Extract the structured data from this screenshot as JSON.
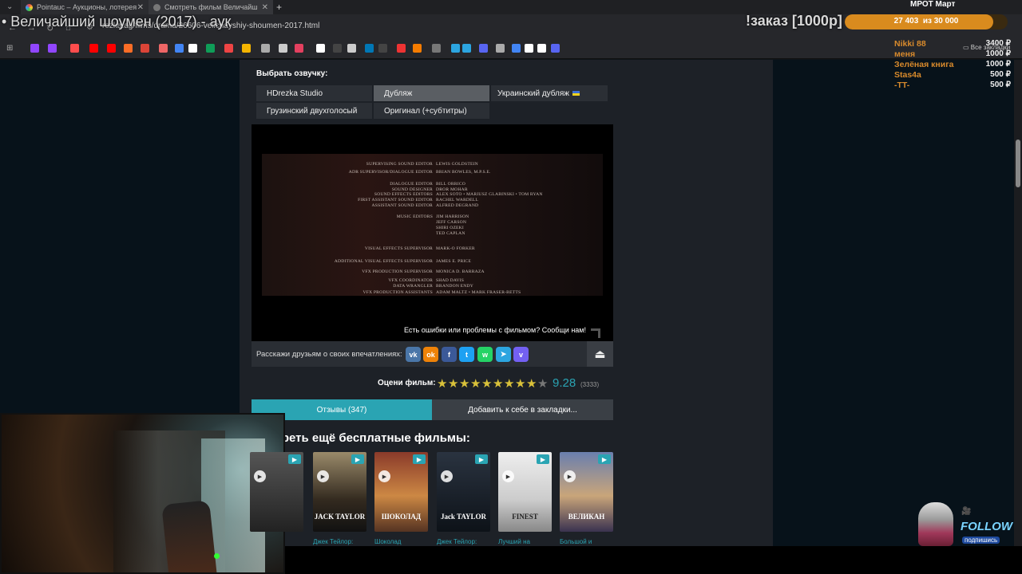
{
  "browser": {
    "tabs": [
      {
        "label": "Pointauc – Аукционы, лотерея"
      },
      {
        "label": "Смотреть фильм Величайш"
      }
    ],
    "url": "rezka.ag/films/drama/26606-velichayshiy-shoumen-2017.html",
    "bookmarks_label": "Все закладки"
  },
  "stream_overlay": {
    "title": "• Величайший шоумен (2017) - аук",
    "order_text": "!заказ [1000р]",
    "goal_current": "27 403",
    "goal_separator": "из",
    "goal_target": "30 000",
    "goal_label": "МРОТ Март",
    "goal_progress": 0.913,
    "donations": [
      {
        "name": "Nikki 88",
        "amount": "3400 ₽"
      },
      {
        "name": "меня",
        "amount": "1000 ₽"
      },
      {
        "name": "Зелёная книга",
        "amount": "1000 ₽"
      },
      {
        "name": "Stas4a",
        "amount": "500 ₽"
      },
      {
        "name": "-TT-",
        "amount": "500 ₽"
      }
    ],
    "follow_text": "FOLLOW",
    "subscribe_text": "подпишись"
  },
  "voiceover": {
    "label": "Выбрать озвучку:",
    "options": [
      "HDrezka Studio",
      "Дубляж",
      "Украинский дубляж",
      "Грузинский двухголосый",
      "Оригинал (+субтитры)"
    ],
    "selected": "Дубляж"
  },
  "credits": [
    {
      "role": "SUPERVISING SOUND EDITOR",
      "names": "LEWIS GOLDSTEIN"
    },
    {
      "role": "ADR SUPERVISOR/DIALOGUE EDITOR",
      "names": "BRIAN BOWLES, M.P.S.E."
    },
    {
      "role": "DIALOGUE EDITOR",
      "names": "BILL ORRICO"
    },
    {
      "role": "SOUND DESIGNER",
      "names": "DROR MOHAR"
    },
    {
      "role": "SOUND EFFECTS EDITORS",
      "names": "ALEX SOTO • MARIUSZ GLABINSKI • TOM RYAN"
    },
    {
      "role": "FIRST ASSISTANT SOUND EDITOR",
      "names": "RACHEL WARDELL"
    },
    {
      "role": "ASSISTANT SOUND EDITOR",
      "names": "ALFRED DEGRAND"
    },
    {
      "role": "MUSIC EDITORS",
      "names": "JIM HARRISON"
    },
    {
      "role": "",
      "names": "JEFF CARSON"
    },
    {
      "role": "",
      "names": "SHIRI OZEKI"
    },
    {
      "role": "",
      "names": "TED CAPLAN"
    },
    {
      "role": "VISUAL EFFECTS SUPERVISOR",
      "names": "MARK-O FORKER"
    },
    {
      "role": "ADDITIONAL VISUAL EFFECTS SUPERVISOR",
      "names": "JAMES E. PRICE"
    },
    {
      "role": "VFX PRODUCTION SUPERVISOR",
      "names": "MONICA D. BARRAZA"
    },
    {
      "role": "VFX COORDINATOR",
      "names": "SHAD DAVIS"
    },
    {
      "role": "DATA WRANGLER",
      "names": "BRANDON ENDY"
    },
    {
      "role": "VFX PRODUCTION ASSISTANTS",
      "names": "ADAM MALTZ • MARK FRASER-BETTS"
    }
  ],
  "player": {
    "report_text": "Есть ошибки или проблемы с фильмом? Сообщи нам!"
  },
  "share": {
    "label": "Расскажи друзьям о своих впечатлениях:",
    "networks": [
      "vk",
      "ok",
      "facebook",
      "twitter",
      "whatsapp",
      "telegram",
      "viber"
    ]
  },
  "rating": {
    "label": "Оцени фильм:",
    "value": "9.28",
    "votes": "(3333)",
    "stars_filled": 9,
    "stars_total": 10
  },
  "tabs": {
    "reviews": "Отзывы (347)",
    "bookmark": "Добавить к себе в закладки..."
  },
  "more": {
    "heading": "Смотреть ещё бесплатные фильмы:",
    "films": [
      {
        "title": "",
        "poster_text": ""
      },
      {
        "title": "Джек Тейлор:",
        "poster_text": "JACK TAYLOR"
      },
      {
        "title": "Шоколад",
        "poster_text": "ШОКОЛАД"
      },
      {
        "title": "Джек Тейлор:",
        "poster_text": "Jack TAYLOR"
      },
      {
        "title": "Лучший на",
        "poster_text": "FINEST"
      },
      {
        "title": "Большой и",
        "poster_text": "ВЕЛИКАН"
      }
    ]
  },
  "colors": {
    "accent": "#2aa4b3",
    "star": "#d9c13a",
    "goal": "#d98b1e",
    "donation_name": "#d88a2c"
  }
}
